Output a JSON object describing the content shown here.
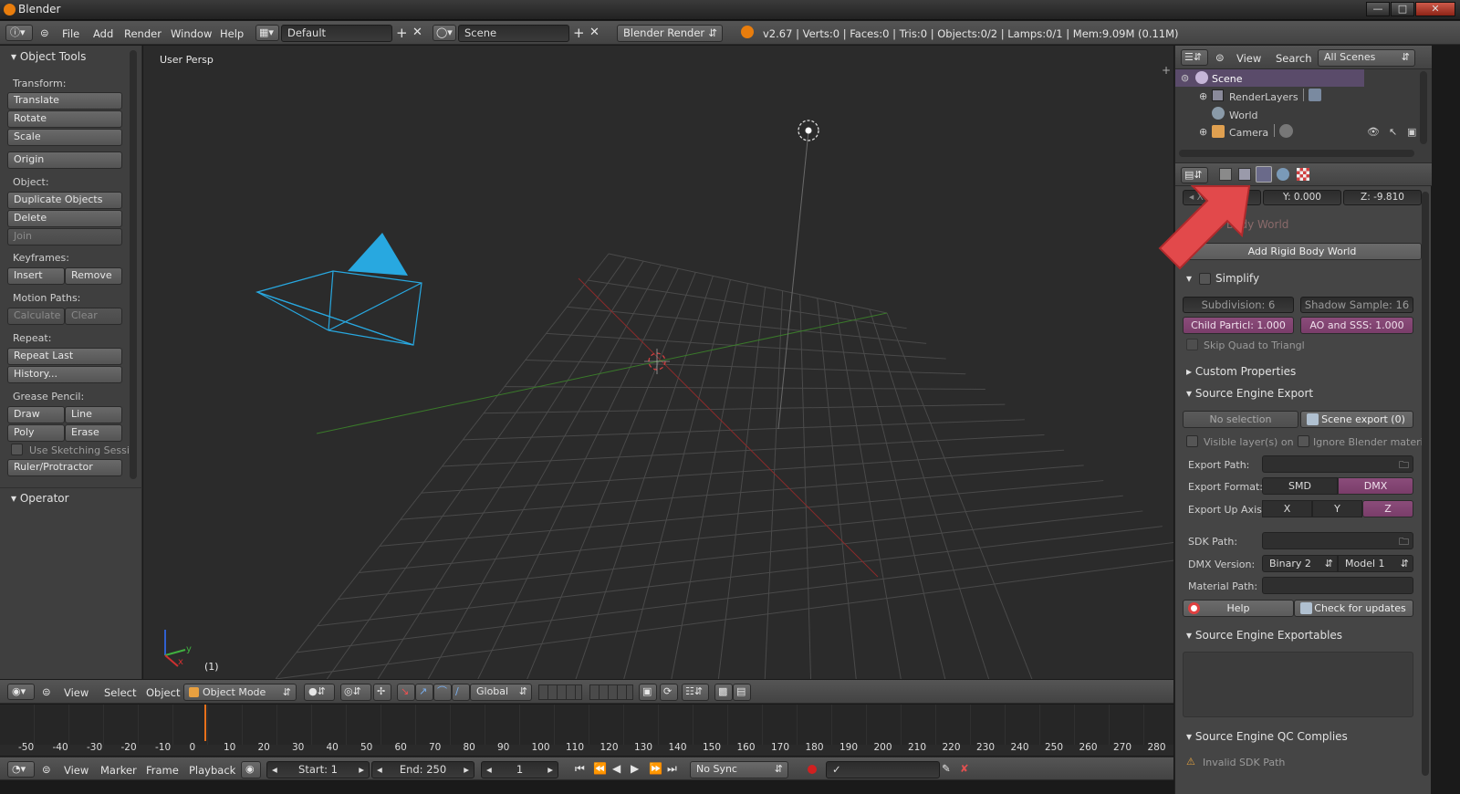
{
  "window": {
    "title": "Blender"
  },
  "info_header": {
    "menus": [
      "File",
      "Add",
      "Render",
      "Window",
      "Help"
    ],
    "layout": "Default",
    "scene": "Scene",
    "engine": "Blender Render",
    "stats": "v2.67 | Verts:0 | Faces:0 | Tris:0 | Objects:0/2 | Lamps:0/1 | Mem:9.09M (0.11M)"
  },
  "toolshelf": {
    "title": "Object Tools",
    "transform_label": "Transform:",
    "translate": "Translate",
    "rotate": "Rotate",
    "scale": "Scale",
    "origin": "Origin",
    "object_label": "Object:",
    "duplicate": "Duplicate Objects",
    "delete": "Delete",
    "join": "Join",
    "keyframes_label": "Keyframes:",
    "insert": "Insert",
    "remove": "Remove",
    "motion_label": "Motion Paths:",
    "calculate": "Calculate",
    "clear": "Clear",
    "repeat_label": "Repeat:",
    "repeat_last": "Repeat Last",
    "history": "History...",
    "grease_label": "Grease Pencil:",
    "draw": "Draw",
    "line": "Line",
    "poly": "Poly",
    "erase": "Erase",
    "sketch": "Use Sketching Sessi",
    "ruler": "Ruler/Protractor",
    "operator": "Operator"
  },
  "viewport": {
    "view_label": "User Persp",
    "frame_label": "(1)",
    "axis_y": "y",
    "axis_x": "x"
  },
  "view3d_header": {
    "view": "View",
    "select": "Select",
    "object": "Object",
    "mode": "Object Mode",
    "orientation": "Global"
  },
  "timeline": {
    "ticks": [
      "-50",
      "-40",
      "-30",
      "-20",
      "-10",
      "0",
      "10",
      "20",
      "30",
      "40",
      "50",
      "60",
      "70",
      "80",
      "90",
      "100",
      "110",
      "120",
      "130",
      "140",
      "150",
      "160",
      "170",
      "180",
      "190",
      "200",
      "210",
      "220",
      "230",
      "240",
      "250",
      "260",
      "270",
      "280"
    ],
    "current_frame": 1,
    "view": "View",
    "marker": "Marker",
    "frame": "Frame",
    "playback": "Playback",
    "start": "Start: 1",
    "end": "End: 250",
    "frame_value": "1",
    "sync": "No Sync"
  },
  "outliner": {
    "view": "View",
    "search": "Search",
    "filter": "All Scenes",
    "items": [
      "Scene",
      "RenderLayers",
      "World",
      "Camera"
    ]
  },
  "properties": {
    "gx": "X: 0.000",
    "gy": "Y: 0.000",
    "gz": "Z: -9.810",
    "rigid_body_world": "Rigid Body World",
    "add_rigid": "Add Rigid Body World",
    "simplify": "Simplify",
    "subdivision": "Subdivision: 6",
    "shadow": "Shadow Sample: 16",
    "child": "Child Particl: 1.000",
    "ao": "AO and SSS: 1.000",
    "skip_quad": "Skip Quad to Triangl",
    "custom_props": "Custom Properties",
    "source_export": "Source Engine Export",
    "no_selection": "No selection",
    "scene_export": "Scene export (0)",
    "visible_layers": "Visible layer(s) on",
    "ignore_materials": "Ignore Blender materi",
    "export_path": "Export Path:",
    "export_format": "Export Format:",
    "smd": "SMD",
    "dmx": "DMX",
    "export_up": "Export Up Axis",
    "ax_x": "X",
    "ax_y": "Y",
    "ax_z": "Z",
    "sdk_path": "SDK Path:",
    "dmx_version": "DMX Version:",
    "binary": "Binary 2",
    "model": "Model 1",
    "material_path": "Material Path:",
    "help": "Help",
    "check_updates": "Check for updates",
    "exportables": "Source Engine Exportables",
    "qc": "Source Engine QC Complies",
    "invalid_sdk": "Invalid SDK Path"
  },
  "colors": {
    "accent_pink": "#8b4c7a",
    "camera_blue": "#28a8e0",
    "arrow_red": "#e2494b"
  }
}
